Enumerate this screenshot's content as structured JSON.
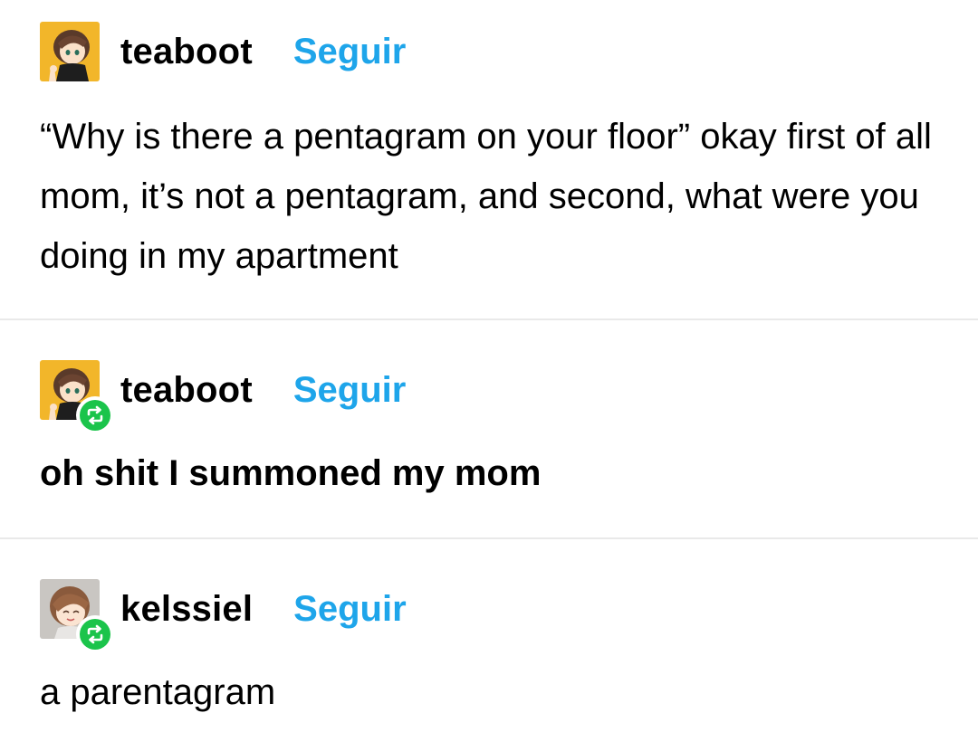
{
  "posts": [
    {
      "username": "teaboot",
      "follow_label": "Seguir",
      "avatar": "anime-character-avatar-yellow",
      "reblogged": false,
      "text": "“Why is there a pentagram on your floor” okay first of all mom, it’s not a pentagram, and second, what were you doing in my apartment"
    },
    {
      "username": "teaboot",
      "follow_label": "Seguir",
      "avatar": "anime-character-avatar-yellow",
      "reblogged": true,
      "text": "oh shit I summoned my mom"
    },
    {
      "username": "kelssiel",
      "follow_label": "Seguir",
      "avatar": "anime-character-avatar-grey",
      "reblogged": true,
      "text": "a parentagram"
    }
  ],
  "colors": {
    "follow": "#1ea5ea",
    "reblog_badge": "#1bc44b",
    "divider": "#e9e9e9"
  },
  "icons": {
    "reblog": "reblog-icon"
  }
}
